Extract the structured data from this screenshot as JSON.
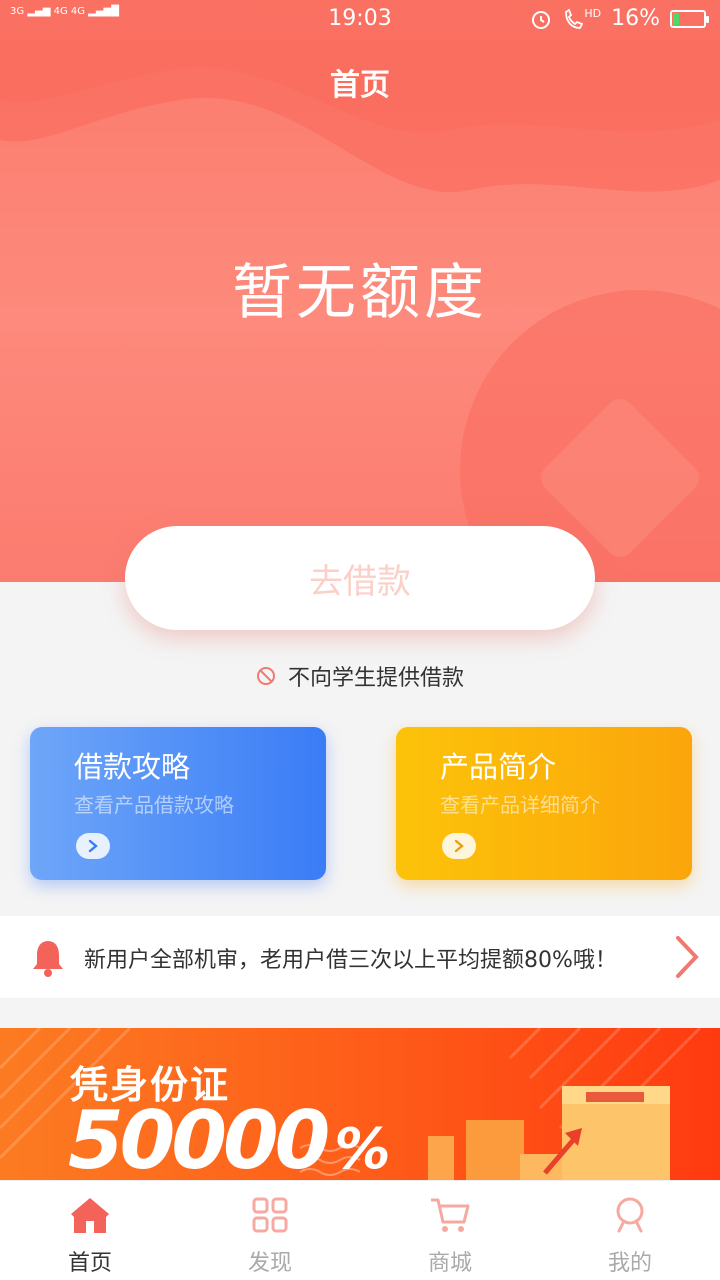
{
  "status_bar": {
    "network_left": "3G",
    "network_right": "4G 4G",
    "time": "19:03",
    "hd": "HD",
    "battery": "16%"
  },
  "header": {
    "title": "首页"
  },
  "hero": {
    "quota_text": "暂无额度",
    "borrow_button": "去借款"
  },
  "notice": {
    "text": "不向学生提供借款"
  },
  "cards": [
    {
      "title": "借款攻略",
      "subtitle": "查看产品借款攻略"
    },
    {
      "title": "产品简介",
      "subtitle": "查看产品详细简介"
    }
  ],
  "announcement": {
    "text": "新用户全部机审，老用户借三次以上平均提额80%哦！"
  },
  "banner": {
    "line1": "凭身份证",
    "line2": "50000",
    "symbol": "%"
  },
  "tabs": [
    {
      "label": "首页",
      "icon": "home-icon",
      "active": true
    },
    {
      "label": "发现",
      "icon": "discover-icon",
      "active": false
    },
    {
      "label": "商城",
      "icon": "cart-icon",
      "active": false
    },
    {
      "label": "我的",
      "icon": "profile-icon",
      "active": false
    }
  ],
  "colors": {
    "brand": "#fb7a6c",
    "blue_card": "#3a7cf6",
    "orange_card": "#fba50b",
    "banner": "#ff5a18"
  }
}
